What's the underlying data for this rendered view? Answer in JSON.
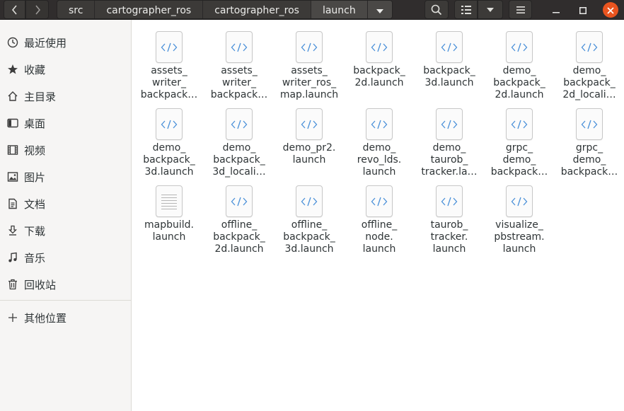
{
  "breadcrumbs": [
    {
      "label": "src"
    },
    {
      "label": "cartographer_ros"
    },
    {
      "label": "cartographer_ros"
    },
    {
      "label": "launch"
    }
  ],
  "icons": {
    "back": "chevron-left-icon",
    "forward": "chevron-right-icon",
    "search": "search-icon",
    "list_view": "list-view-icon",
    "view_options": "chevron-down-icon",
    "menu": "hamburger-menu-icon",
    "minimize": "minimize-icon",
    "maximize": "maximize-icon",
    "close": "close-icon"
  },
  "colors": {
    "headerbar": "#302d2d",
    "close_button": "#e9541f",
    "code_icon_accent": "#4a90d9",
    "sidebar_bg": "#f6f5f4"
  },
  "sidebar": {
    "items": [
      {
        "label": "最近使用",
        "icon": "clock-icon"
      },
      {
        "label": "收藏",
        "icon": "star-icon"
      },
      {
        "label": "主目录",
        "icon": "home-icon"
      },
      {
        "label": "桌面",
        "icon": "desktop-icon"
      },
      {
        "label": "视频",
        "icon": "video-icon"
      },
      {
        "label": "图片",
        "icon": "picture-icon"
      },
      {
        "label": "文档",
        "icon": "document-icon"
      },
      {
        "label": "下载",
        "icon": "download-icon"
      },
      {
        "label": "音乐",
        "icon": "music-icon"
      },
      {
        "label": "回收站",
        "icon": "trash-icon"
      }
    ],
    "other_locations": {
      "label": "其他位置",
      "icon": "plus-icon"
    }
  },
  "files": [
    {
      "name": "assets_\nwriter_\nbackpack…",
      "type": "code"
    },
    {
      "name": "assets_\nwriter_\nbackpack…",
      "type": "code"
    },
    {
      "name": "assets_\nwriter_ros_\nmap.launch",
      "type": "code"
    },
    {
      "name": "backpack_\n2d.launch",
      "type": "code"
    },
    {
      "name": "backpack_\n3d.launch",
      "type": "code"
    },
    {
      "name": "demo_\nbackpack_\n2d.launch",
      "type": "code"
    },
    {
      "name": "demo_\nbackpack_\n2d_locali…",
      "type": "code"
    },
    {
      "name": "demo_\nbackpack_\n3d.launch",
      "type": "code"
    },
    {
      "name": "demo_\nbackpack_\n3d_locali…",
      "type": "code"
    },
    {
      "name": "demo_pr2.\nlaunch",
      "type": "code"
    },
    {
      "name": "demo_\nrevo_lds.\nlaunch",
      "type": "code"
    },
    {
      "name": "demo_\ntaurob_\ntracker.la…",
      "type": "code"
    },
    {
      "name": "grpc_\ndemo_\nbackpack…",
      "type": "code"
    },
    {
      "name": "grpc_\ndemo_\nbackpack…",
      "type": "code"
    },
    {
      "name": "mapbuild.\nlaunch",
      "type": "text"
    },
    {
      "name": "offline_\nbackpack_\n2d.launch",
      "type": "code"
    },
    {
      "name": "offline_\nbackpack_\n3d.launch",
      "type": "code"
    },
    {
      "name": "offline_\nnode.\nlaunch",
      "type": "code"
    },
    {
      "name": "taurob_\ntracker.\nlaunch",
      "type": "code"
    },
    {
      "name": "visualize_\npbstream.\nlaunch",
      "type": "code"
    }
  ]
}
